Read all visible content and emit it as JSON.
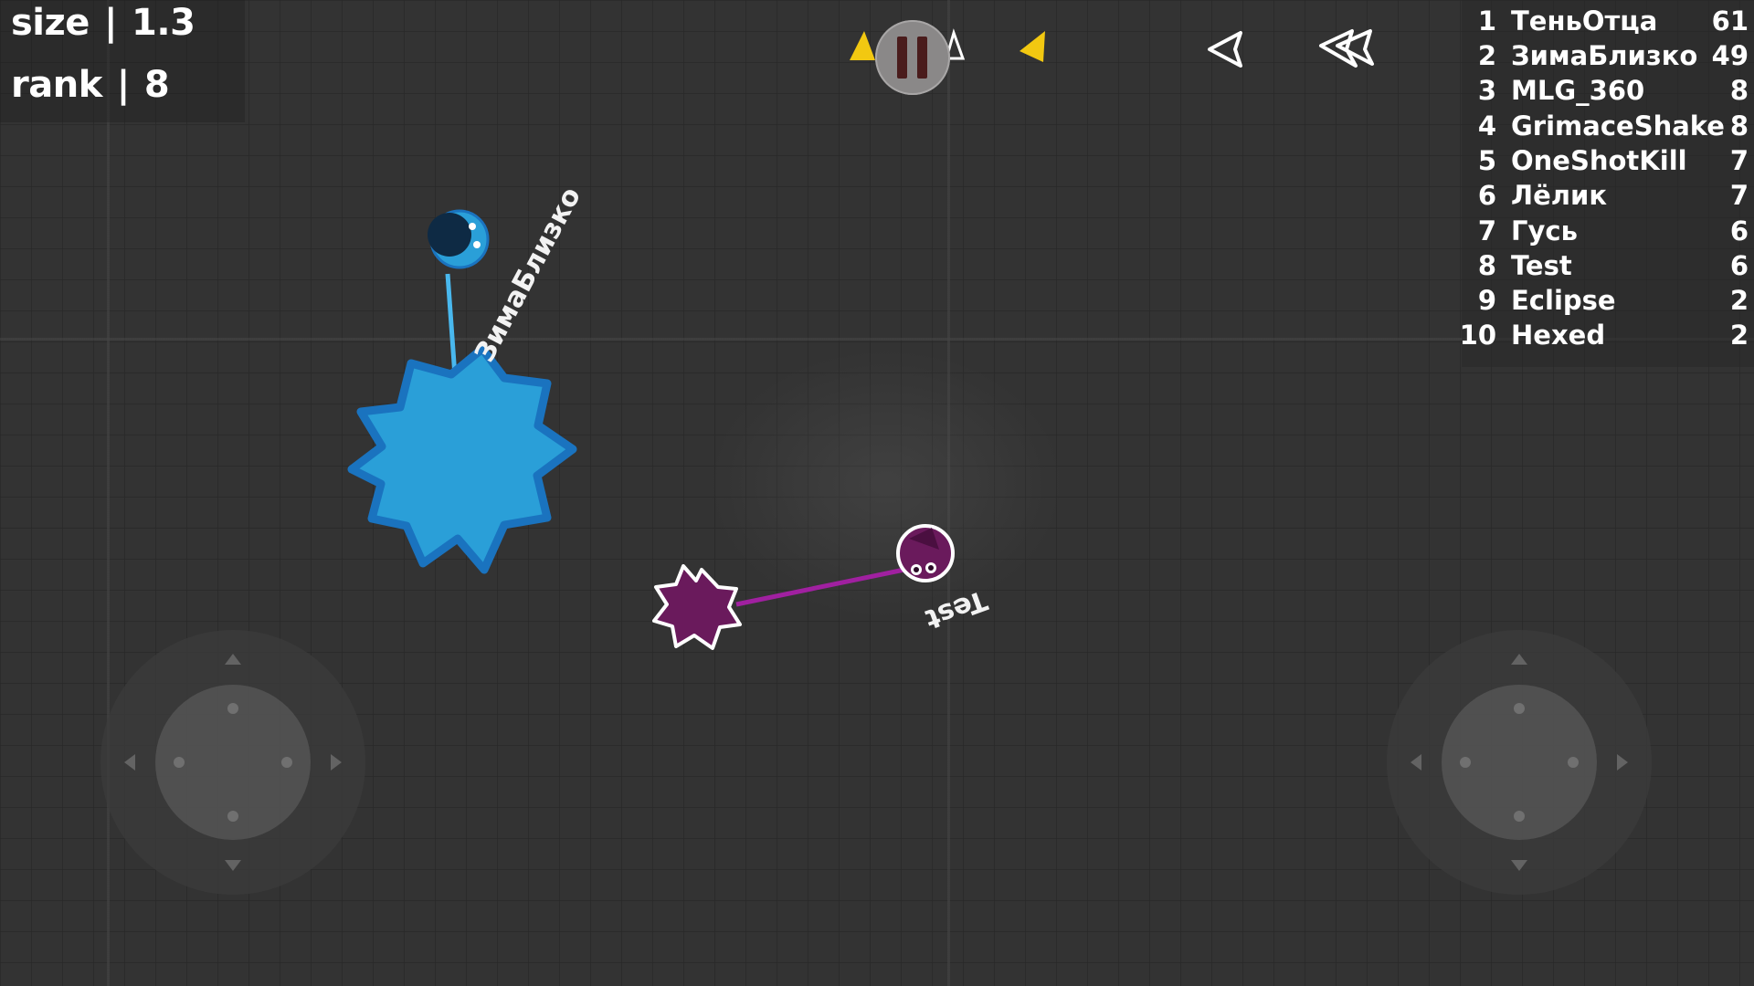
{
  "hud": {
    "size_label": "size",
    "size_value": "1.3",
    "rank_label": "rank",
    "rank_value": "8"
  },
  "leaderboard": [
    {
      "rank": "1",
      "name": "ТеньОтца",
      "score": "61"
    },
    {
      "rank": "2",
      "name": "ЗимаБлизко",
      "score": "49"
    },
    {
      "rank": "3",
      "name": "MLG_360",
      "score": "8"
    },
    {
      "rank": "4",
      "name": "GrimaceShake",
      "score": "8"
    },
    {
      "rank": "5",
      "name": "OneShotKill",
      "score": "7"
    },
    {
      "rank": "6",
      "name": "Лёлик",
      "score": "7"
    },
    {
      "rank": "7",
      "name": "Гусь",
      "score": "6"
    },
    {
      "rank": "8",
      "name": "Test",
      "score": "6"
    },
    {
      "rank": "9",
      "name": "Eclipse",
      "score": "2"
    },
    {
      "rank": "10",
      "name": "Hexed",
      "score": "2"
    }
  ],
  "players": {
    "blue": {
      "name": "ЗимаБлизко",
      "color": "#2a9fd8",
      "outline": "#1a73bf"
    },
    "purple": {
      "name": "Test",
      "color": "#6a1a5c",
      "outline": "#ffffff"
    }
  },
  "icons": {
    "pause": "pause-icon",
    "offscreen_markers": "yellow-triangle-icon",
    "back": "back-arrow-icon",
    "rewind": "double-back-arrow-icon"
  },
  "colors": {
    "background": "#333333",
    "marker_yellow": "#f2c811",
    "text": "#ffffff"
  }
}
